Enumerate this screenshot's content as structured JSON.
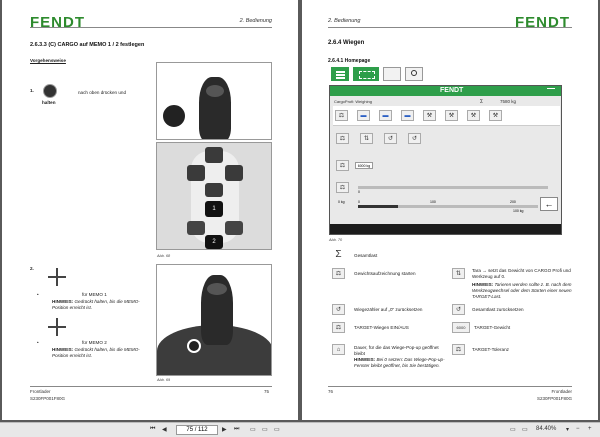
{
  "left_page": {
    "logo": "FENDT",
    "chapter": "2. Bedienung",
    "section_title": "2.6.3.3  (C) CARGO auf MEMO 1 / 2 festlegen",
    "procedure_label": "Vorgehensweise",
    "step1_num": "1.",
    "step1_text_a": "nach oben drücken und",
    "step1_text_b": "halten",
    "step2_num": "2.",
    "memo1_text": "für MEMO 1",
    "hint1_label": "HINWEIS:",
    "hint1_text": "Gedrückt halten, bis die MEMO-Position erreicht ist.",
    "memo2_text": "für MEMO 2",
    "hint2_label": "HINWEIS:",
    "hint2_text": "Gedrückt halten, bis die MEMO-Position erreicht ist.",
    "fig_caption_1": "Abb. 68",
    "fig_caption_2": "Abb. 69",
    "key_1": "1",
    "key_2": "2",
    "footer_left_line1": "Frontlader",
    "footer_left_line2": "S230FP001F80G",
    "footer_page": "75"
  },
  "right_page": {
    "logo": "FENDT",
    "chapter": "2. Bedienung",
    "section_title": "2.6.4  Wiegen",
    "subsection_title": "2.6.4.1  Homepage",
    "screen": {
      "brand": "FENDT",
      "profile_label": "CargoProfi: Weighing",
      "sum_value": "7580 kg",
      "weight_box": "6000 kg",
      "scale_0": "0",
      "scale_100": "100",
      "scale_200": "200",
      "tare_value": "0 kg",
      "tare_scale_0": "0",
      "tare_scale_100": "100",
      "tare_scale_200": "200",
      "tare_right": "100 kg"
    },
    "fig_caption": "Abb. 70",
    "legend": [
      {
        "icon": "Σ",
        "text": "Gesamtlast"
      },
      {
        "icon": "⚖",
        "text": "Gewichtsaufzeichnung starten"
      },
      {
        "icon": "↺",
        "text": "Wiegezähler auf „0“ zurücksetzen"
      },
      {
        "icon": "⚖",
        "text": "TARGET-Wiegen EIN/AUS"
      },
      {
        "icon": "⌂",
        "text": "Dauer, für die das Wiege-Pop-up geöffnet bleibt"
      }
    ],
    "legend_right": [
      {
        "icon": "⇅",
        "text": "Tara → setzt das Gewicht von CARGO Profi und Werkzeug auf 0."
      },
      {
        "icon": "↺",
        "text": "Gesamtlast zurücksetzen"
      },
      {
        "icon": "6000",
        "text": "TARGET-Gewicht"
      },
      {
        "icon": "⚖",
        "text": "TARGET-Toleranz"
      }
    ],
    "hint_tare_label": "HINWEIS:",
    "hint_tare_text": "Tarieren werden sollte z. B. nach dem Werkzeugwechsel oder dem Starten einer neuen TARGET-Last.",
    "hint_popup_label": "HINWEIS:",
    "hint_popup_text": "Bei 0 setzen: Das Wiege-Pop-up-Fenster bleibt geöffnet, bis Sie bestätigen.",
    "footer_page": "76",
    "footer_right_line1": "Frontlader",
    "footer_right_line2": "S230FP001F80G"
  },
  "viewer_bar": {
    "page_indicator": "75 / 112",
    "zoom": "84.40%"
  }
}
